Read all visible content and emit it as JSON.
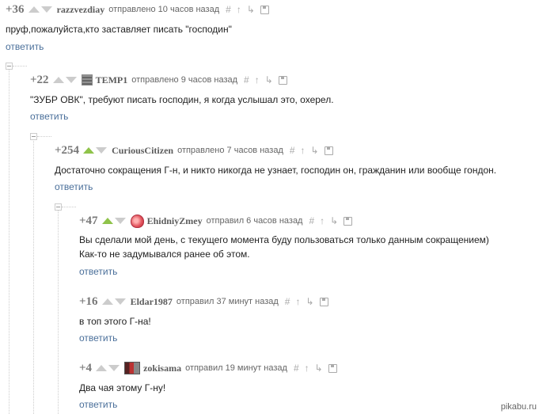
{
  "comments": [
    {
      "rating": "+36",
      "user": "razzvezdiay",
      "time": "отправлено 10 часов назад",
      "lines": [
        "пруф,пожалуйста,кто заставляет писать \"господин\""
      ],
      "reply": "ответить"
    },
    {
      "rating": "+22",
      "user": "TEMP1",
      "time": "отправлено 9 часов назад",
      "lines": [
        "\"ЗУБР ОВК\", требуют писать господин, я когда услышал это, охерел."
      ],
      "reply": "ответить"
    },
    {
      "rating": "+254",
      "user": "CuriousCitizen",
      "time": "отправлено 7 часов назад",
      "lines": [
        "Достаточно сокращения Г-н, и никто никогда не узнает, господин он, гражданин или вообще гондон."
      ],
      "reply": "ответить"
    },
    {
      "rating": "+47",
      "user": "EhidniyZmey",
      "time": "отправил 6 часов назад",
      "lines": [
        "Вы сделали мой день, с текущего момента буду пользоваться только данным сокращением)",
        "Как-то не задумывался ранее об этом."
      ],
      "reply": "ответить"
    },
    {
      "rating": "+16",
      "user": "Eldar1987",
      "time": "отправил 37 минут назад",
      "lines": [
        "в топ этого Г-на!"
      ],
      "reply": "ответить"
    },
    {
      "rating": "+4",
      "user": "zokisama",
      "time": "отправил 19 минут назад",
      "lines": [
        "Два чая этому Г-ну!"
      ],
      "reply": "ответить"
    }
  ],
  "icons": [
    "hash-icon",
    "arrow-up-icon",
    "branch-icon",
    "save-icon"
  ],
  "watermark": "pikabu.ru",
  "colors": {
    "accent_vote_up": "#8fc34a",
    "link": "#4a6f9a"
  }
}
